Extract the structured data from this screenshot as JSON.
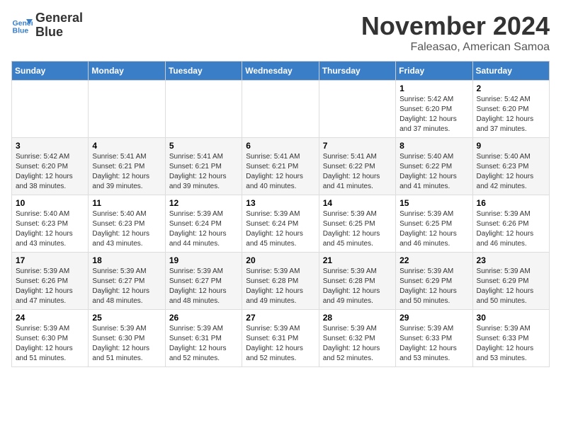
{
  "header": {
    "logo_line1": "General",
    "logo_line2": "Blue",
    "month_title": "November 2024",
    "subtitle": "Faleasao, American Samoa"
  },
  "days_of_week": [
    "Sunday",
    "Monday",
    "Tuesday",
    "Wednesday",
    "Thursday",
    "Friday",
    "Saturday"
  ],
  "weeks": [
    [
      {
        "day": "",
        "info": ""
      },
      {
        "day": "",
        "info": ""
      },
      {
        "day": "",
        "info": ""
      },
      {
        "day": "",
        "info": ""
      },
      {
        "day": "",
        "info": ""
      },
      {
        "day": "1",
        "info": "Sunrise: 5:42 AM\nSunset: 6:20 PM\nDaylight: 12 hours and 37 minutes."
      },
      {
        "day": "2",
        "info": "Sunrise: 5:42 AM\nSunset: 6:20 PM\nDaylight: 12 hours and 37 minutes."
      }
    ],
    [
      {
        "day": "3",
        "info": "Sunrise: 5:42 AM\nSunset: 6:20 PM\nDaylight: 12 hours and 38 minutes."
      },
      {
        "day": "4",
        "info": "Sunrise: 5:41 AM\nSunset: 6:21 PM\nDaylight: 12 hours and 39 minutes."
      },
      {
        "day": "5",
        "info": "Sunrise: 5:41 AM\nSunset: 6:21 PM\nDaylight: 12 hours and 39 minutes."
      },
      {
        "day": "6",
        "info": "Sunrise: 5:41 AM\nSunset: 6:21 PM\nDaylight: 12 hours and 40 minutes."
      },
      {
        "day": "7",
        "info": "Sunrise: 5:41 AM\nSunset: 6:22 PM\nDaylight: 12 hours and 41 minutes."
      },
      {
        "day": "8",
        "info": "Sunrise: 5:40 AM\nSunset: 6:22 PM\nDaylight: 12 hours and 41 minutes."
      },
      {
        "day": "9",
        "info": "Sunrise: 5:40 AM\nSunset: 6:23 PM\nDaylight: 12 hours and 42 minutes."
      }
    ],
    [
      {
        "day": "10",
        "info": "Sunrise: 5:40 AM\nSunset: 6:23 PM\nDaylight: 12 hours and 43 minutes."
      },
      {
        "day": "11",
        "info": "Sunrise: 5:40 AM\nSunset: 6:23 PM\nDaylight: 12 hours and 43 minutes."
      },
      {
        "day": "12",
        "info": "Sunrise: 5:39 AM\nSunset: 6:24 PM\nDaylight: 12 hours and 44 minutes."
      },
      {
        "day": "13",
        "info": "Sunrise: 5:39 AM\nSunset: 6:24 PM\nDaylight: 12 hours and 45 minutes."
      },
      {
        "day": "14",
        "info": "Sunrise: 5:39 AM\nSunset: 6:25 PM\nDaylight: 12 hours and 45 minutes."
      },
      {
        "day": "15",
        "info": "Sunrise: 5:39 AM\nSunset: 6:25 PM\nDaylight: 12 hours and 46 minutes."
      },
      {
        "day": "16",
        "info": "Sunrise: 5:39 AM\nSunset: 6:26 PM\nDaylight: 12 hours and 46 minutes."
      }
    ],
    [
      {
        "day": "17",
        "info": "Sunrise: 5:39 AM\nSunset: 6:26 PM\nDaylight: 12 hours and 47 minutes."
      },
      {
        "day": "18",
        "info": "Sunrise: 5:39 AM\nSunset: 6:27 PM\nDaylight: 12 hours and 48 minutes."
      },
      {
        "day": "19",
        "info": "Sunrise: 5:39 AM\nSunset: 6:27 PM\nDaylight: 12 hours and 48 minutes."
      },
      {
        "day": "20",
        "info": "Sunrise: 5:39 AM\nSunset: 6:28 PM\nDaylight: 12 hours and 49 minutes."
      },
      {
        "day": "21",
        "info": "Sunrise: 5:39 AM\nSunset: 6:28 PM\nDaylight: 12 hours and 49 minutes."
      },
      {
        "day": "22",
        "info": "Sunrise: 5:39 AM\nSunset: 6:29 PM\nDaylight: 12 hours and 50 minutes."
      },
      {
        "day": "23",
        "info": "Sunrise: 5:39 AM\nSunset: 6:29 PM\nDaylight: 12 hours and 50 minutes."
      }
    ],
    [
      {
        "day": "24",
        "info": "Sunrise: 5:39 AM\nSunset: 6:30 PM\nDaylight: 12 hours and 51 minutes."
      },
      {
        "day": "25",
        "info": "Sunrise: 5:39 AM\nSunset: 6:30 PM\nDaylight: 12 hours and 51 minutes."
      },
      {
        "day": "26",
        "info": "Sunrise: 5:39 AM\nSunset: 6:31 PM\nDaylight: 12 hours and 52 minutes."
      },
      {
        "day": "27",
        "info": "Sunrise: 5:39 AM\nSunset: 6:31 PM\nDaylight: 12 hours and 52 minutes."
      },
      {
        "day": "28",
        "info": "Sunrise: 5:39 AM\nSunset: 6:32 PM\nDaylight: 12 hours and 52 minutes."
      },
      {
        "day": "29",
        "info": "Sunrise: 5:39 AM\nSunset: 6:33 PM\nDaylight: 12 hours and 53 minutes."
      },
      {
        "day": "30",
        "info": "Sunrise: 5:39 AM\nSunset: 6:33 PM\nDaylight: 12 hours and 53 minutes."
      }
    ]
  ]
}
